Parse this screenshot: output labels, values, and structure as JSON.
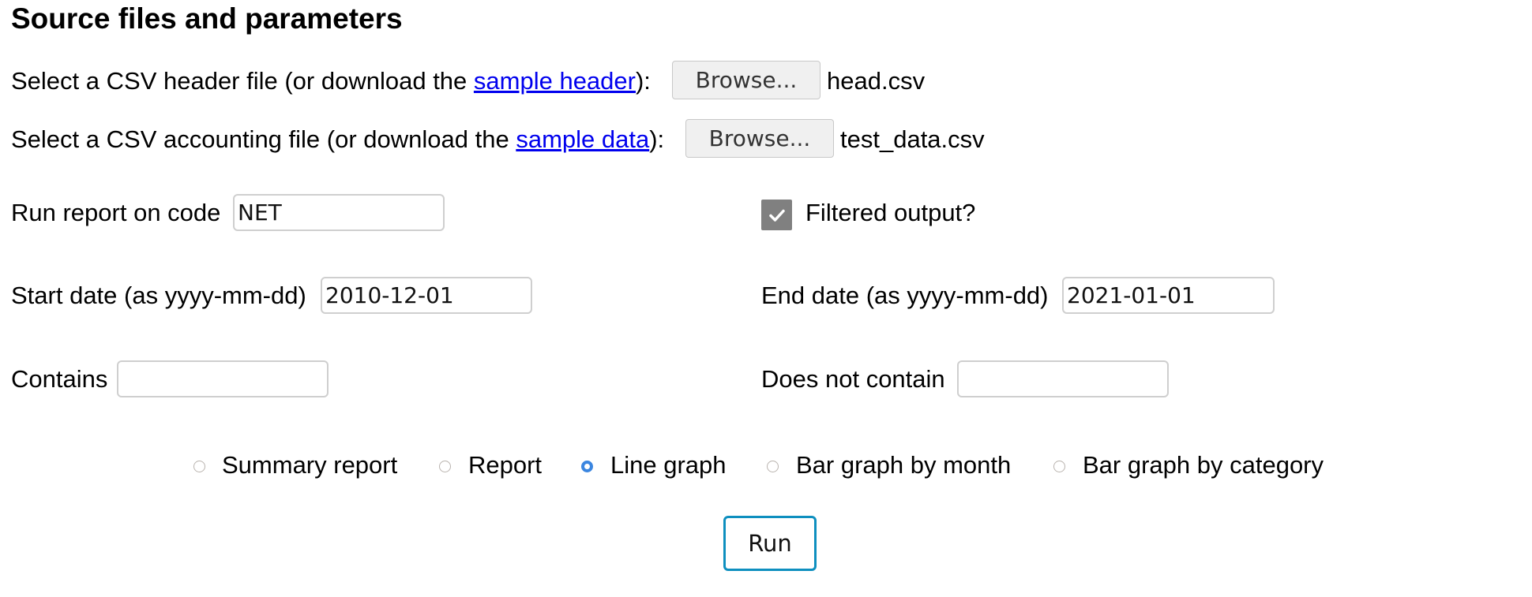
{
  "page": {
    "title": "Source files and parameters"
  },
  "header_file": {
    "prefix": "Select a CSV header file (or download the ",
    "link_label": "sample header",
    "suffix": "):",
    "browse_label": "Browse...",
    "selected_file": "head.csv"
  },
  "data_file": {
    "prefix": "Select a CSV accounting file (or download the ",
    "link_label": "sample data",
    "suffix": "):",
    "browse_label": "Browse...",
    "selected_file": "test_data.csv"
  },
  "code": {
    "label": "Run report on code",
    "value": "NET"
  },
  "filtered": {
    "label": "Filtered output?",
    "checked": true
  },
  "start_date": {
    "label": "Start date (as yyyy-mm-dd)",
    "value": "2010-12-01"
  },
  "end_date": {
    "label": "End date (as yyyy-mm-dd)",
    "value": "2021-01-01"
  },
  "contains": {
    "label": "Contains",
    "value": ""
  },
  "not_contains": {
    "label": "Does not contain",
    "value": ""
  },
  "report_types": {
    "selected": "Line graph",
    "options": [
      {
        "label": "Summary report",
        "checked": false
      },
      {
        "label": "Report",
        "checked": false
      },
      {
        "label": "Line graph",
        "checked": true
      },
      {
        "label": "Bar graph by month",
        "checked": false
      },
      {
        "label": "Bar graph by category",
        "checked": false
      }
    ]
  },
  "run_button": {
    "label": "Run"
  },
  "colors": {
    "link": "#0000ee",
    "radio_selected": "#3b86e0",
    "run_border": "#0e8fbf",
    "checkbox_fill": "#808080"
  }
}
